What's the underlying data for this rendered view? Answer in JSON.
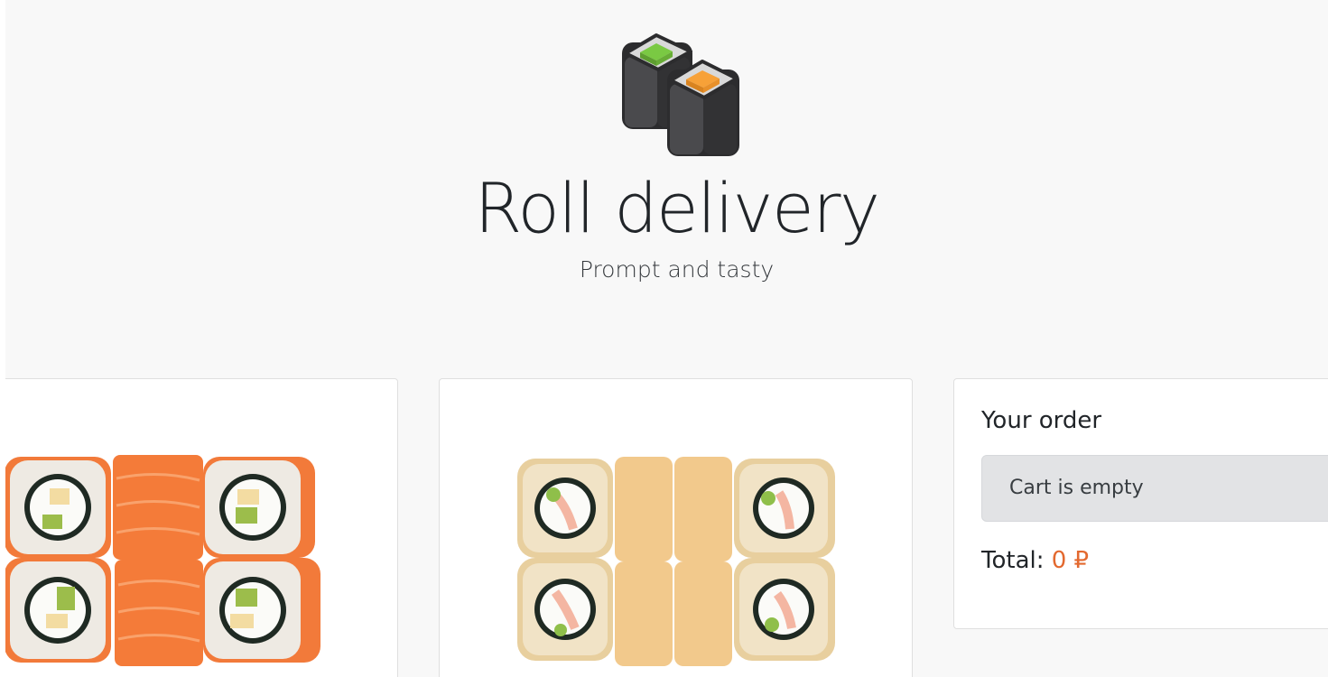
{
  "header": {
    "title": "Roll delivery",
    "subtitle": "Prompt and tasty",
    "logo_icon": "sushi-rolls-icon"
  },
  "products": [
    {
      "image": "salmon-roll-icon"
    },
    {
      "image": "tempura-roll-icon"
    }
  ],
  "cart": {
    "title": "Your order",
    "empty_message": "Cart is empty",
    "total_label": "Total:",
    "total_value": "0 ₽"
  },
  "colors": {
    "background": "#f8f8f8",
    "card": "#ffffff",
    "accent": "#e3692f",
    "alert_empty": "#e2e3e5",
    "logo_green": "#7ac943",
    "logo_orange": "#f7a138"
  }
}
